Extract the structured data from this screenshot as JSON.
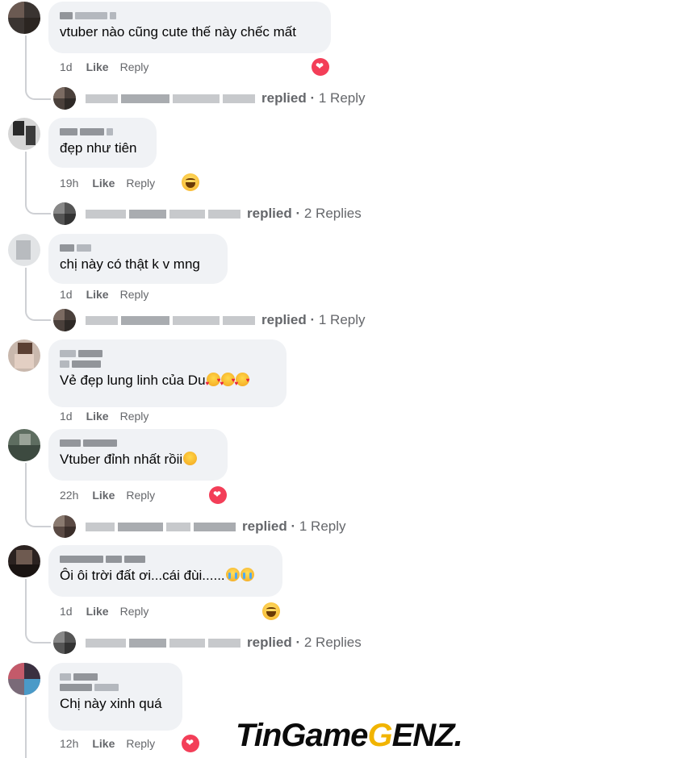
{
  "comments": [
    {
      "text": "vtuber nào cũng cute thế này chếc mất",
      "time": "1d",
      "like": "Like",
      "reply": "Reply",
      "reaction": "heart",
      "replies": {
        "label": "replied",
        "count": "1 Reply"
      }
    },
    {
      "text": "đẹp như tiên",
      "time": "19h",
      "like": "Like",
      "reply": "Reply",
      "reaction": "haha",
      "replies": {
        "label": "replied",
        "count": "2 Replies"
      }
    },
    {
      "text": "chị này có thật k v mng",
      "time": "1d",
      "like": "Like",
      "reply": "Reply",
      "reaction": "",
      "replies": {
        "label": "replied",
        "count": "1 Reply"
      }
    },
    {
      "text": "Vẻ đẹp lung linh của Du",
      "time": "1d",
      "like": "Like",
      "reply": "Reply",
      "reaction": ""
    },
    {
      "text": "Vtuber đỉnh nhất rồii",
      "time": "22h",
      "like": "Like",
      "reply": "Reply",
      "reaction": "heart",
      "replies": {
        "label": "replied",
        "count": "1 Reply"
      }
    },
    {
      "text": "Ôi ôi trời đất ơi...cái đùi......",
      "time": "1d",
      "like": "Like",
      "reply": "Reply",
      "reaction": "haha",
      "replies": {
        "label": "replied",
        "count": "2 Replies"
      }
    },
    {
      "text": "Chị này xinh quá",
      "time": "12h",
      "like": "Like",
      "reply": "Reply",
      "reaction": "heart"
    }
  ],
  "watermark": {
    "part1": "TinGame",
    "part2": "GENZ",
    "part3": "."
  },
  "colors": {
    "bubble": "#f0f2f5",
    "meta": "#65676b",
    "heart": "#f33e58",
    "brand_yellow": "#f1b400"
  }
}
